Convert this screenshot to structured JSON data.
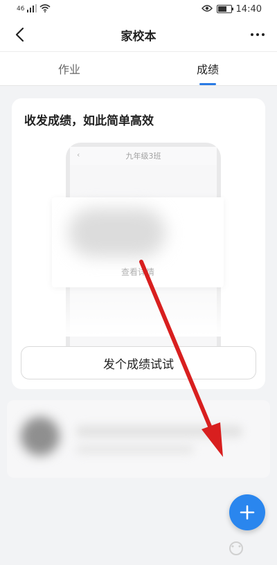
{
  "status_bar": {
    "time": "14:40",
    "left_label": "46",
    "icons": [
      "signal-icon",
      "wifi-icon",
      "eye-icon",
      "battery-icon"
    ]
  },
  "navbar": {
    "title": "家校本",
    "back_icon": "chevron-left-icon",
    "more_icon": "more-horizontal-icon"
  },
  "tabs": [
    {
      "label": "作业",
      "active": false
    },
    {
      "label": "成绩",
      "active": true
    }
  ],
  "promo_card": {
    "title": "收发成绩，如此简单高效",
    "preview_header": "九年级3班",
    "preview_link": "查看详情",
    "button_label": "发个成绩试试"
  },
  "fab": {
    "icon": "plus-icon"
  },
  "colors": {
    "accent": "#2a7be4",
    "fab": "#2a86ee",
    "arrow": "#e02020"
  }
}
